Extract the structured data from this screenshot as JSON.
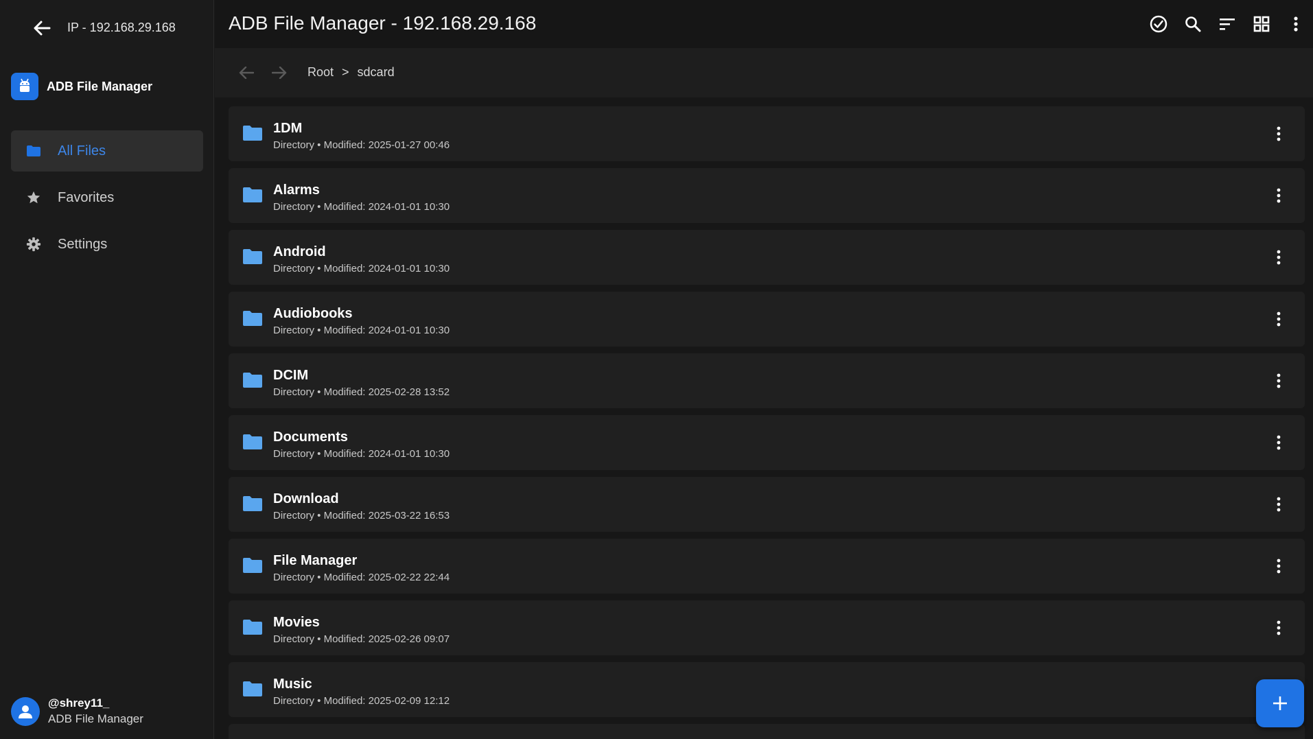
{
  "sidebar": {
    "ip_label": "IP - 192.168.29.168",
    "brand_name": "ADB File Manager",
    "items": [
      {
        "label": "All Files",
        "icon": "folder-icon",
        "active": true
      },
      {
        "label": "Favorites",
        "icon": "star-icon",
        "active": false
      },
      {
        "label": "Settings",
        "icon": "gear-icon",
        "active": false
      }
    ],
    "user": {
      "handle": "@shrey11_",
      "app": "ADB File Manager"
    }
  },
  "header": {
    "title": "ADB File Manager - 192.168.29.168",
    "actions": [
      "select-all-icon",
      "search-icon",
      "sort-icon",
      "grid-view-icon",
      "more-vert-icon"
    ]
  },
  "breadcrumb": {
    "items": [
      "Root",
      "sdcard"
    ],
    "separator": ">"
  },
  "files": [
    {
      "name": "1DM",
      "meta": "Directory • Modified: 2025-01-27 00:46"
    },
    {
      "name": "Alarms",
      "meta": "Directory • Modified: 2024-01-01 10:30"
    },
    {
      "name": "Android",
      "meta": "Directory • Modified: 2024-01-01 10:30"
    },
    {
      "name": "Audiobooks",
      "meta": "Directory • Modified: 2024-01-01 10:30"
    },
    {
      "name": "DCIM",
      "meta": "Directory • Modified: 2025-02-28 13:52"
    },
    {
      "name": "Documents",
      "meta": "Directory • Modified: 2024-01-01 10:30"
    },
    {
      "name": "Download",
      "meta": "Directory • Modified: 2025-03-22 16:53"
    },
    {
      "name": "File Manager",
      "meta": "Directory • Modified: 2025-02-22 22:44"
    },
    {
      "name": "Movies",
      "meta": "Directory • Modified: 2025-02-26 09:07"
    },
    {
      "name": "Music",
      "meta": "Directory • Modified: 2025-02-09 12:12"
    }
  ],
  "colors": {
    "accent": "#1f73e4",
    "folder": "#5aa6ee",
    "background": "#171717",
    "row": "#202020"
  }
}
